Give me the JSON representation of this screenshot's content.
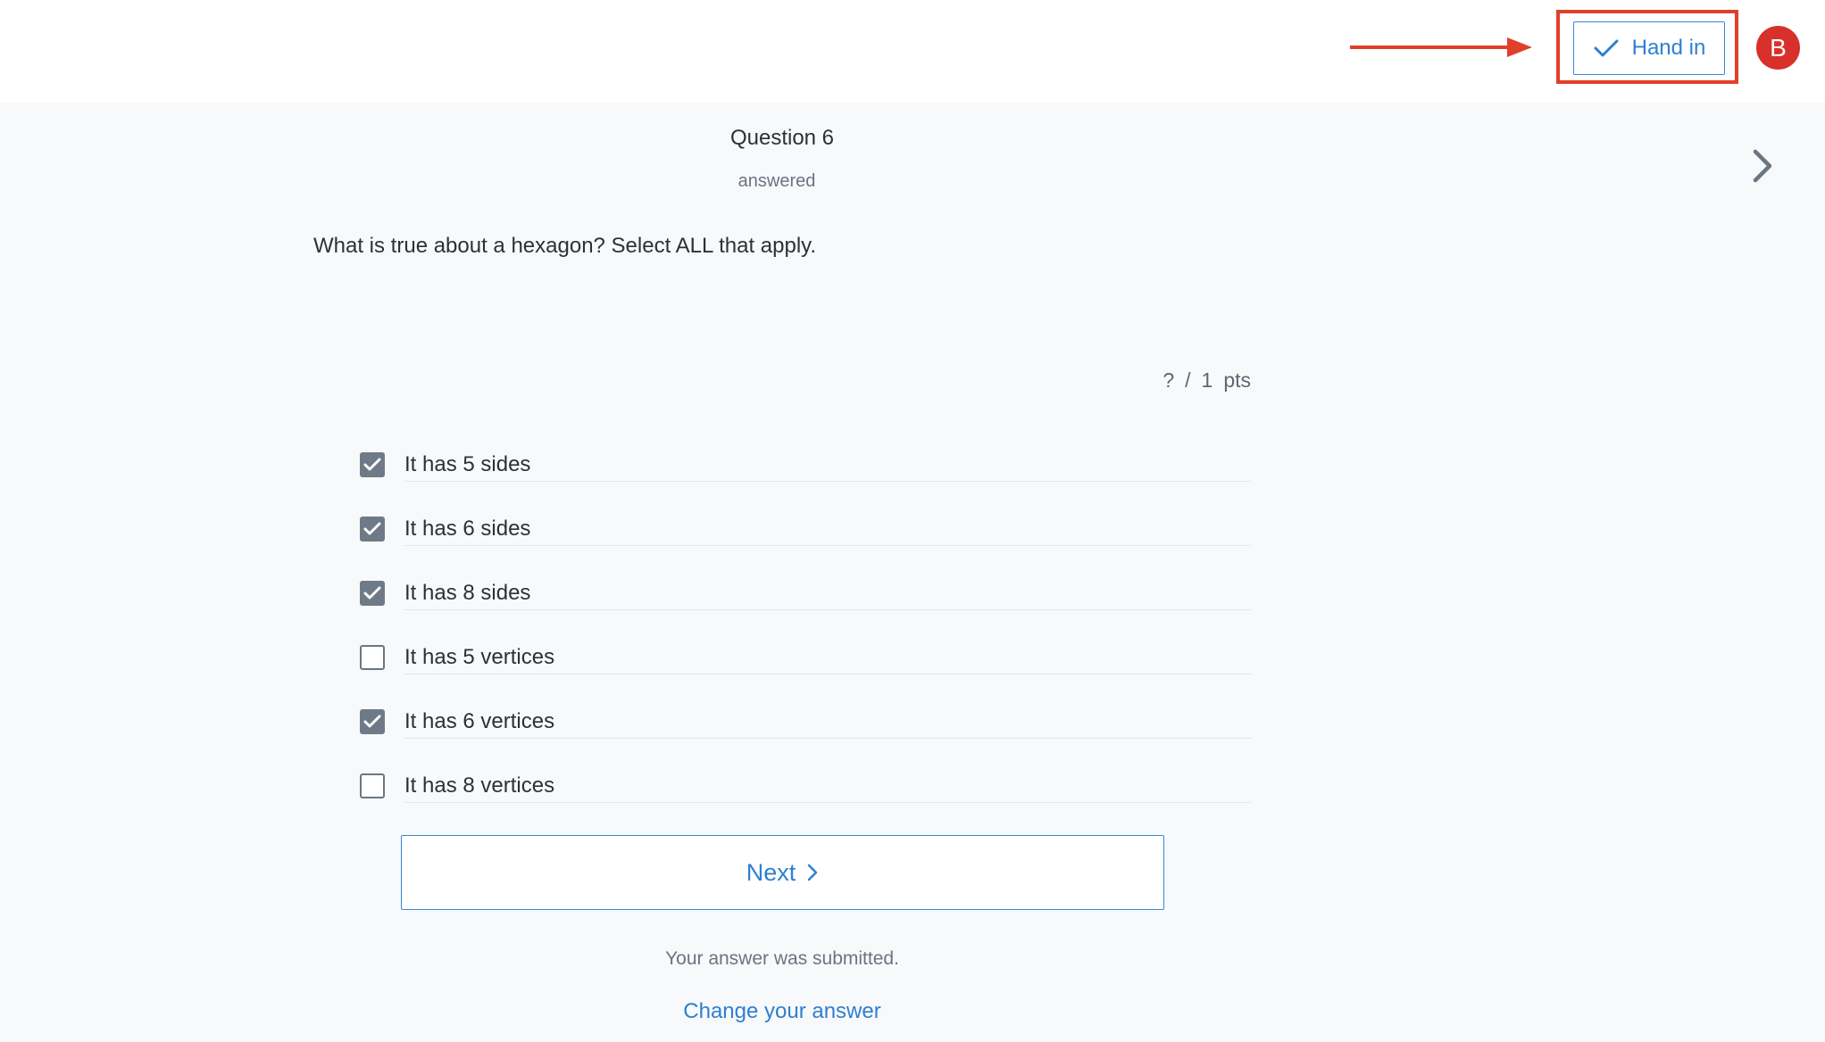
{
  "header": {
    "hand_in_label": "Hand in",
    "avatar_initial": "B",
    "annotation_color": "#e0402a"
  },
  "question": {
    "title": "Question 6",
    "status": "answered",
    "text": "What is true about a hexagon? Select ALL that apply.",
    "points": {
      "earned": "?",
      "separator": "/",
      "total": "1",
      "unit": "pts"
    }
  },
  "options": [
    {
      "label": "It has 5 sides",
      "checked": true
    },
    {
      "label": "It has 6 sides",
      "checked": true
    },
    {
      "label": "It has 8 sides",
      "checked": true
    },
    {
      "label": "It has 5 vertices",
      "checked": false
    },
    {
      "label": "It has 6 vertices",
      "checked": true
    },
    {
      "label": "It has 8 vertices",
      "checked": false
    }
  ],
  "footer": {
    "next_label": "Next",
    "submitted_text": "Your answer was submitted.",
    "change_label": "Change your answer"
  },
  "colors": {
    "accent": "#2f7fd0",
    "avatar_bg": "#d8302a",
    "checkbox_checked": "#6e7a87"
  }
}
